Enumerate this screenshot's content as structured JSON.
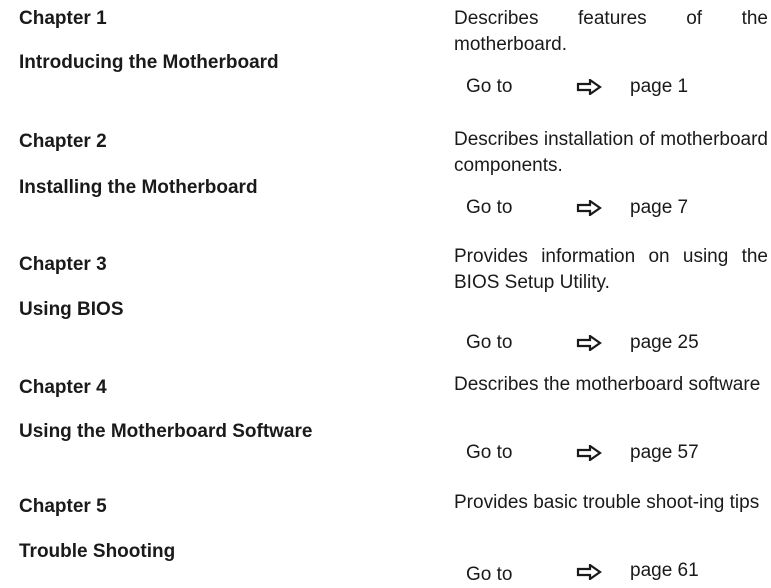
{
  "chapters": [
    {
      "number": "Chapter 1",
      "title": "Introducing the Motherboard",
      "description": "Describes features of the motherboard.",
      "goto_label": "Go to",
      "page": "page 1"
    },
    {
      "number": "Chapter 2",
      "title": "Installing the Motherboard",
      "description": "Describes installation of motherboard components.",
      "goto_label": "Go to",
      "page": "page 7"
    },
    {
      "number": "Chapter 3",
      "title": "Using BIOS",
      "description": "Provides information on using the BIOS Setup Utility.",
      "goto_label": "Go to",
      "page": "page 25"
    },
    {
      "number": "Chapter 4",
      "title": "Using the Motherboard Software",
      "description": "Describes the motherboard software",
      "goto_label": "Go to",
      "page": "page 57"
    },
    {
      "number": "Chapter 5",
      "title": "Trouble Shooting",
      "description": "Provides basic trouble shoot-ing tips",
      "goto_label": "Go to",
      "page": "page 61"
    }
  ],
  "icons": {
    "goto_arrow": "right-arrow-icon"
  },
  "colors": {
    "text": "#1a1a1a",
    "background": "#ffffff"
  }
}
